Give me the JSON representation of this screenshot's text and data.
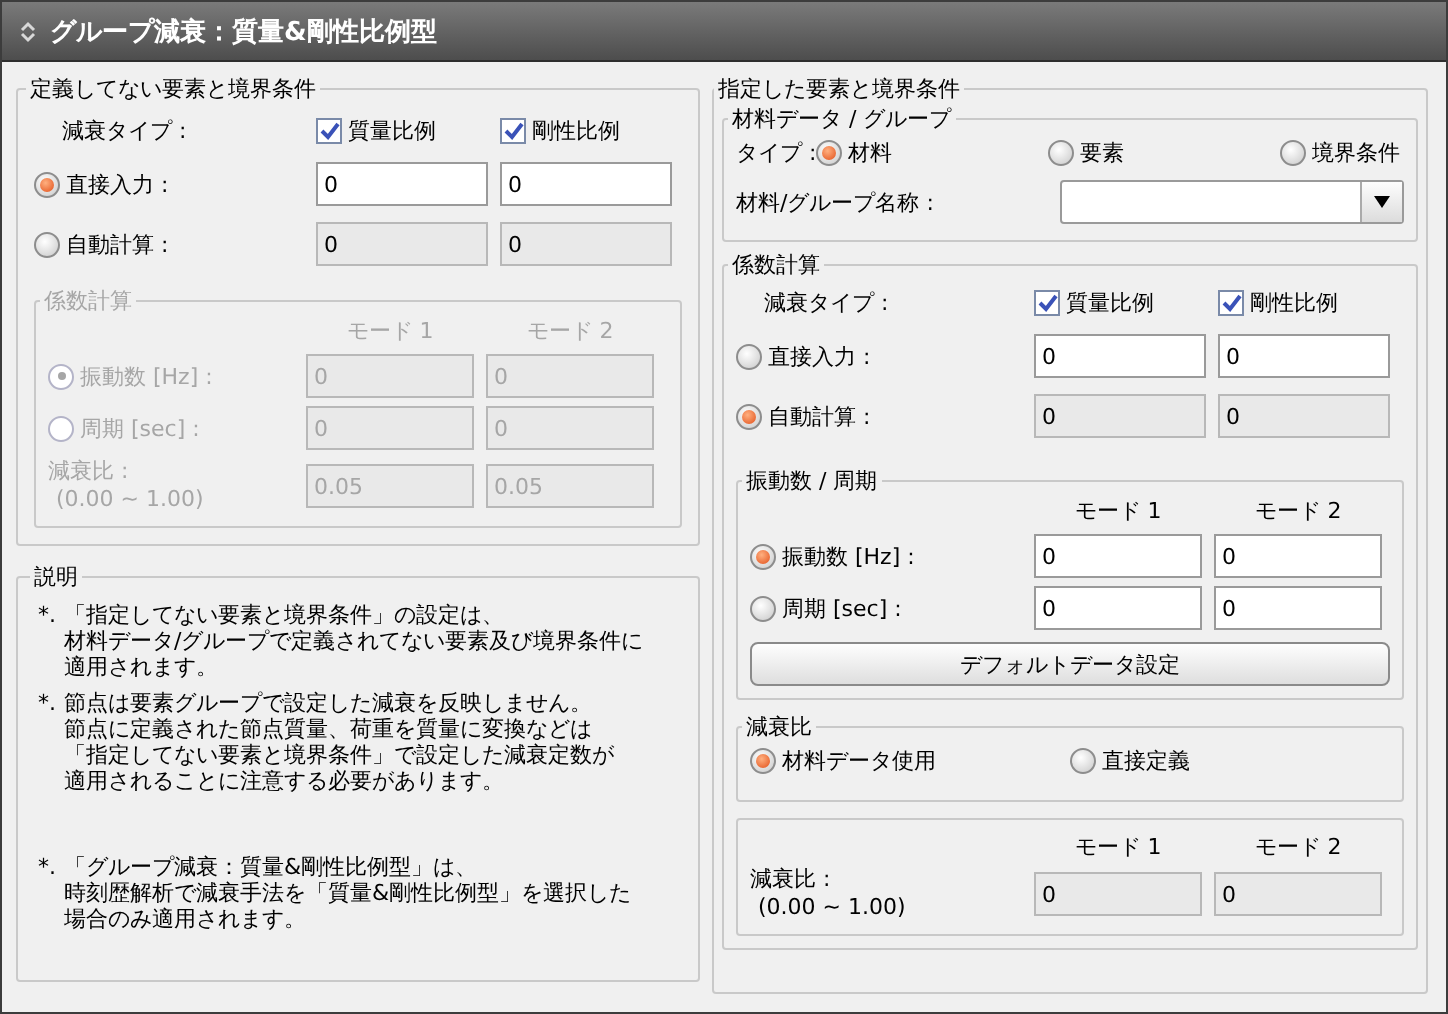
{
  "title": "グループ減衰：質量&剛性比例型",
  "undefined_panel": {
    "title": "定義してない要素と境界条件",
    "damping_type": {
      "label": "減衰タイプ :",
      "options": [
        {
          "label": "質量比例",
          "checked": true
        },
        {
          "label": "剛性比例",
          "checked": true
        }
      ]
    },
    "methods": [
      {
        "label": "直接入力 :",
        "selected": true,
        "values": [
          "0",
          "0"
        ],
        "disabled": false
      },
      {
        "label": "自動計算 :",
        "selected": false,
        "values": [
          "0",
          "0"
        ],
        "disabled": true
      }
    ],
    "coef": {
      "title": "係数計算",
      "disabled": true,
      "columns": [
        "モード 1",
        "モード 2"
      ],
      "rows": [
        {
          "label": "振動数 [Hz] :",
          "selected": true,
          "values": [
            "0",
            "0"
          ]
        },
        {
          "label": "周期 [sec] :",
          "selected": false,
          "values": [
            "0",
            "0"
          ]
        }
      ],
      "ratio": {
        "label": "減衰比 :",
        "range": "(0.00 ~ 1.00)",
        "values": [
          "0.05",
          "0.05"
        ]
      }
    }
  },
  "notes": {
    "title": "説明",
    "items": [
      {
        "bullet": "*.",
        "lines": [
          "「指定してない要素と境界条件」の設定は、",
          "材料データ/グループで定義されてない要素及び境界条件に",
          "適用されます。"
        ]
      },
      {
        "bullet": "*.",
        "lines": [
          "節点は要素グループで設定した減衰を反映しません。",
          "節点に定義された節点質量、荷重を質量に変換などは",
          "「指定してない要素と境界条件」で設定した減衰定数が",
          "適用されることに注意する必要があります。"
        ]
      },
      {
        "bullet": "*.",
        "lines": [
          "「グループ減衰：質量&剛性比例型」は、",
          "時刻歴解析で減衰手法を「質量&剛性比例型」を選択した",
          "場合のみ適用されます。"
        ]
      }
    ]
  },
  "defined_panel": {
    "title": "指定した要素と境界条件",
    "material_group": {
      "title": "材料データ / グループ",
      "type_label": "タイプ :",
      "types": [
        {
          "label": "材料",
          "selected": true
        },
        {
          "label": "要素",
          "selected": false
        },
        {
          "label": "境界条件",
          "selected": false
        }
      ],
      "name_label": "材料/グループ名称 :"
    },
    "coef": {
      "title": "係数計算",
      "damping_type": {
        "label": "減衰タイプ :",
        "options": [
          {
            "label": "質量比例",
            "checked": true
          },
          {
            "label": "剛性比例",
            "checked": true
          }
        ]
      },
      "methods": [
        {
          "label": "直接入力 :",
          "selected": false,
          "values": [
            "0",
            "0"
          ],
          "disabled": false
        },
        {
          "label": "自動計算 :",
          "selected": true,
          "values": [
            "0",
            "0"
          ],
          "disabled": true
        }
      ],
      "freq": {
        "title": "振動数 / 周期",
        "columns": [
          "モード 1",
          "モード 2"
        ],
        "rows": [
          {
            "label": "振動数 [Hz] :",
            "selected": true,
            "values": [
              "0",
              "0"
            ]
          },
          {
            "label": "周期 [sec] :",
            "selected": false,
            "values": [
              "0",
              "0"
            ]
          }
        ],
        "button": "デフォルトデータ設定"
      },
      "ratio": {
        "title": "減衰比",
        "options": [
          {
            "label": "材料データ使用",
            "selected": true
          },
          {
            "label": "直接定義",
            "selected": false
          }
        ],
        "columns": [
          "モード 1",
          "モード 2"
        ],
        "label": "減衰比 :",
        "range": "(0.00 ~ 1.00)",
        "values": [
          "0",
          "0"
        ],
        "disabled": true
      }
    }
  }
}
